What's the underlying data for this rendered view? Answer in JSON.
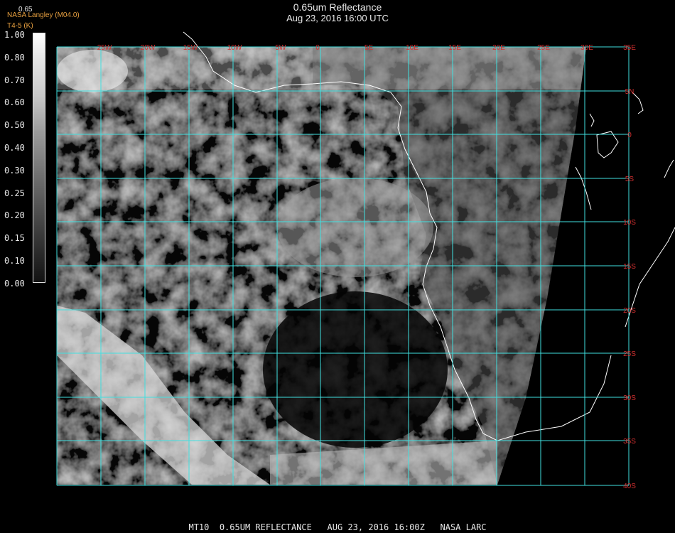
{
  "title_line1": "0.65um Reflectance",
  "title_line2": "Aug 23, 2016 16:00 UTC",
  "credit_line1": "NASA Langley (M04.0)",
  "credit_line2": "T4-5 (K)",
  "scale_top": "0.65",
  "colorbar_ticks": [
    "1.00",
    "0.80",
    "0.70",
    "0.60",
    "0.50",
    "0.40",
    "0.30",
    "0.25",
    "0.20",
    "0.15",
    "0.10",
    "0.00"
  ],
  "lon_labels": [
    "25W",
    "20W",
    "15W",
    "10W",
    "5W",
    "0",
    "5E",
    "10E",
    "15E",
    "20E",
    "25E",
    "30E"
  ],
  "lat_labels": [
    "35E",
    "5N",
    "0",
    "5S",
    "10S",
    "15S",
    "20S",
    "25S",
    "30S",
    "35S",
    "40S"
  ],
  "footer": "MT10  0.65UM REFLECTANCE   AUG 23, 2016 16:00Z   NASA LARC",
  "colors": {
    "grid": "#40e0e0",
    "coast": "#ffffff",
    "label": "#d43030",
    "credit": "#e8a040"
  }
}
